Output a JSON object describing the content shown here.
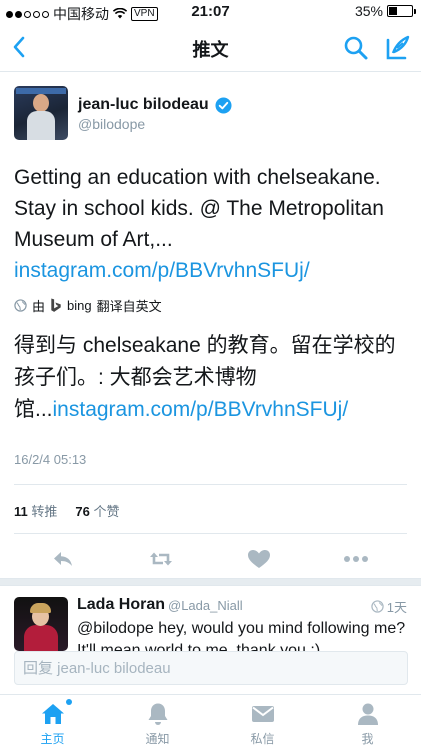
{
  "status_bar": {
    "carrier": "中国移动",
    "vpn": "VPN",
    "time": "21:07",
    "battery": "35%",
    "battery_level": 0.35
  },
  "navbar": {
    "title": "推文",
    "back_icon": "chevron-left-icon",
    "search_icon": "search-icon",
    "compose_icon": "compose-icon"
  },
  "tweet": {
    "author_name": "jean-luc bilodeau",
    "author_handle": "@bilodope",
    "verified": true,
    "text_plain": "Getting an education with chelseakane. Stay in school kids. @ The Metropolitan Museum of Art,... ",
    "text_link": "instagram.com/p/BBVrvhnSFUj/",
    "translate_by": "由",
    "translate_engine": "bing",
    "translate_note": "翻译自英文",
    "translated_plain": "得到与 chelseakane 的教育。留在学校的孩子们。: 大都会艺术博物馆...",
    "translated_link": "instagram.com/p/BBVrvhnSFUj/",
    "timestamp": "16/2/4 05:13",
    "retweet_count": "11",
    "retweet_label": "转推",
    "like_count": "76",
    "like_label": "个赞"
  },
  "reply": {
    "name": "Lada Horan",
    "handle": "@Lada_Niall",
    "time": "1天",
    "text": "@bilodope hey, would you mind following me? It'll mean world to me, thank you :)"
  },
  "reply_box": {
    "placeholder": "回复 jean-luc bilodeau"
  },
  "tabbar": {
    "home": "主页",
    "notifications": "通知",
    "messages": "私信",
    "me": "我"
  },
  "colors": {
    "accent": "#1da1f2",
    "link": "#1b95e0",
    "muted": "#8899a6"
  }
}
